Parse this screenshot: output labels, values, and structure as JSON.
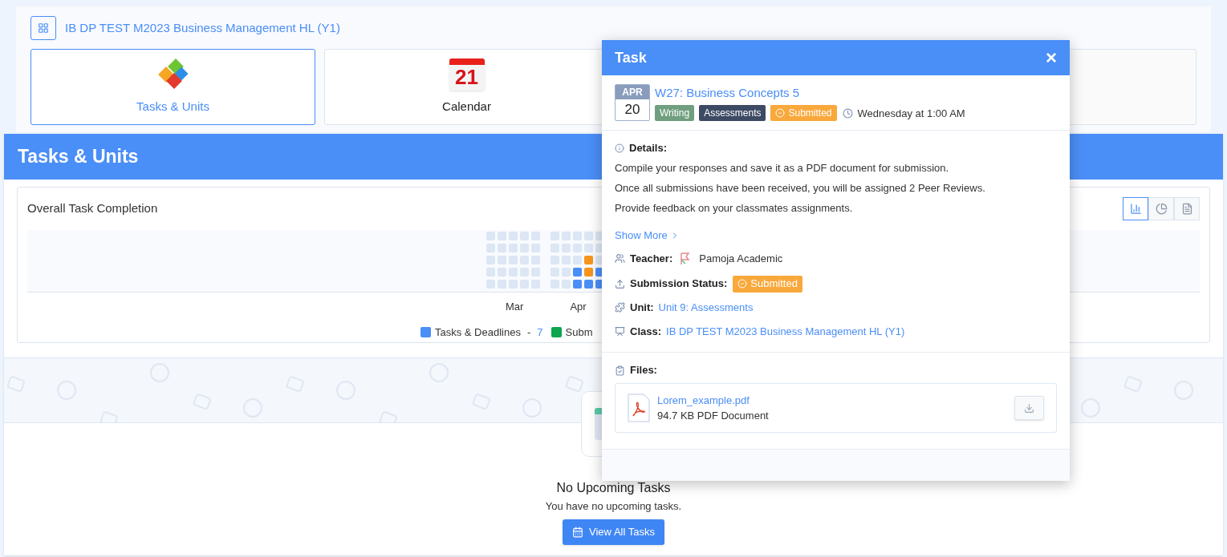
{
  "course": {
    "title": "IB DP TEST M2023 Business Management HL (Y1)"
  },
  "tiles": [
    {
      "kind": "puzzle",
      "label": "Tasks & Units",
      "selected": true
    },
    {
      "kind": "calendar",
      "label": "Calendar",
      "icon_text": "21",
      "selected": false
    }
  ],
  "panel": {
    "title": "Tasks & Units"
  },
  "completion": {
    "title": "Overall Task Completion",
    "months": [
      "Mar",
      "Apr"
    ],
    "view_buttons": [
      {
        "kind": "bar",
        "selected": true
      },
      {
        "kind": "pie",
        "selected": false
      },
      {
        "kind": "notes",
        "selected": false
      }
    ],
    "legend": [
      {
        "label": "Tasks & Deadlines",
        "separator": "-",
        "count": "7",
        "color": "#4a8ef7"
      },
      {
        "label": "Subm",
        "color": "#0ea54f"
      }
    ]
  },
  "empty_state": {
    "title": "No Upcoming Tasks",
    "message": "You have no upcoming tasks.",
    "button": "View All Tasks"
  },
  "modal": {
    "title": "Task",
    "close": "×",
    "date": {
      "month": "APR",
      "day": "20"
    },
    "task_title": "W27: Business Concepts 5",
    "tags": [
      {
        "kind": "category",
        "label": "Writing",
        "color": "#6f9f7f"
      },
      {
        "kind": "category",
        "label": "Assessments",
        "color": "#3d4a63"
      },
      {
        "kind": "status",
        "label": "Submitted",
        "color": "#f9a83b"
      }
    ],
    "due": "Wednesday at 1:00 AM",
    "details_label": "Details:",
    "details": [
      "Compile your responses and save it as a PDF document for submission.",
      "Once all submissions have been received, you will be assigned 2 Peer Reviews.",
      "Provide feedback on your classmates assignments."
    ],
    "show_more": "Show More",
    "teacher": {
      "label": "Teacher:",
      "value": "Pamoja Academic"
    },
    "submission": {
      "label": "Submission Status:",
      "value": "Submitted"
    },
    "unit": {
      "label": "Unit:",
      "value": "Unit 9: Assessments"
    },
    "class": {
      "label": "Class:",
      "value": "IB DP TEST M2023 Business Management HL (Y1)"
    },
    "files_label": "Files:",
    "files": [
      {
        "name": "Lorem_example.pdf",
        "meta": "94.7 KB PDF Document"
      }
    ]
  }
}
